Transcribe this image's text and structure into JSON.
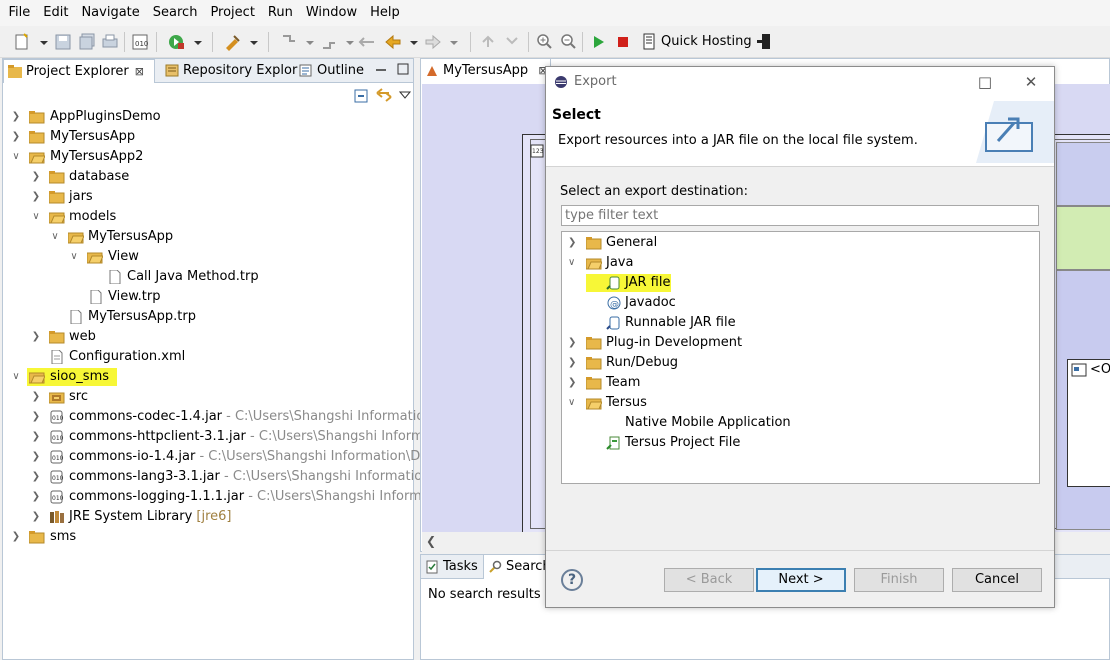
{
  "menu": [
    "File",
    "Edit",
    "Navigate",
    "Search",
    "Project",
    "Run",
    "Window",
    "Help"
  ],
  "toolbar": {
    "quick_hosting": "Quick Hosting"
  },
  "left_panel": {
    "tabs": [
      {
        "label": "Project Explorer",
        "close": "⊠"
      },
      {
        "label": "Repository Explor"
      },
      {
        "label": "Outline"
      }
    ],
    "tree": [
      {
        "label": "AppPluginsDemo"
      },
      {
        "label": "MyTersusApp"
      },
      {
        "label": "MyTersusApp2"
      },
      {
        "label": "database"
      },
      {
        "label": "jars"
      },
      {
        "label": "models"
      },
      {
        "label": "MyTersusApp"
      },
      {
        "label": "View"
      },
      {
        "label": "Call Java Method.trp"
      },
      {
        "label": "View.trp"
      },
      {
        "label": "MyTersusApp.trp"
      },
      {
        "label": "web"
      },
      {
        "label": "Configuration.xml"
      },
      {
        "label": "sioo_sms"
      },
      {
        "label": "src"
      },
      {
        "label": "commons-codec-1.4.jar",
        "decoration": " - C:\\Users\\Shangshi Information\\De"
      },
      {
        "label": "commons-httpclient-3.1.jar",
        "decoration": " - C:\\Users\\Shangshi Information"
      },
      {
        "label": "commons-io-1.4.jar",
        "decoration": " - C:\\Users\\Shangshi Information\\Deskto"
      },
      {
        "label": "commons-lang3-3.1.jar",
        "decoration": " - C:\\Users\\Shangshi Information\\De"
      },
      {
        "label": "commons-logging-1.1.1.jar",
        "decoration": " - C:\\Users\\Shangshi Information"
      },
      {
        "label": "JRE System Library",
        "decoration": " [jre6]"
      },
      {
        "label": "sms"
      }
    ]
  },
  "editor": {
    "tab": "MyTersusApp",
    "close": "⊠",
    "box_label": "<O"
  },
  "bottom_panel": {
    "tabs": [
      {
        "label": "Tasks"
      },
      {
        "label": "Search"
      }
    ],
    "no_results": "No search results av"
  },
  "dialog": {
    "title": "Export",
    "header_title": "Select",
    "header_desc": "Export resources into a JAR file on the local file system.",
    "dest_label": "Select an export destination:",
    "filter_placeholder": "type filter text",
    "tree": [
      {
        "label": "General"
      },
      {
        "label": "Java"
      },
      {
        "label": "JAR file"
      },
      {
        "label": "Javadoc"
      },
      {
        "label": "Runnable JAR file"
      },
      {
        "label": "Plug-in Development"
      },
      {
        "label": "Run/Debug"
      },
      {
        "label": "Team"
      },
      {
        "label": "Tersus"
      },
      {
        "label": "Native Mobile Application"
      },
      {
        "label": "Tersus Project File"
      }
    ],
    "buttons": {
      "back": "< Back",
      "next": "Next >",
      "finish": "Finish",
      "cancel": "Cancel",
      "help": "?"
    }
  },
  "colors": {
    "highlight": "#f7f737",
    "folder": "#e8b84a",
    "accent_blue": "#3c7fb1"
  }
}
